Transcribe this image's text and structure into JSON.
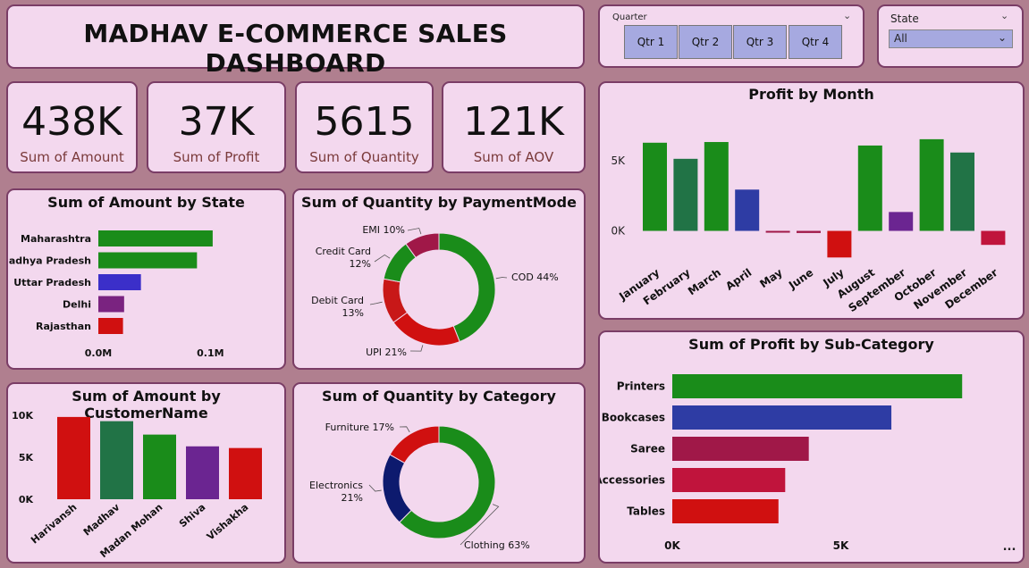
{
  "header": {
    "title": "MADHAV E-COMMERCE SALES DASHBOARD"
  },
  "quarter_slicer": {
    "label": "Quarter",
    "options": [
      "Qtr 1",
      "Qtr 2",
      "Qtr 3",
      "Qtr 4"
    ]
  },
  "state_slicer": {
    "label": "State",
    "selected": "All"
  },
  "kpis": [
    {
      "value": "438K",
      "label": "Sum of Amount"
    },
    {
      "value": "37K",
      "label": "Sum of Profit"
    },
    {
      "value": "5615",
      "label": "Sum of Quantity"
    },
    {
      "value": "121K",
      "label": "Sum of AOV"
    }
  ],
  "colors": {
    "green": "#1a8c1a",
    "dark_green": "#217346",
    "blue": "#2e3ca4",
    "purple": "#6b2591",
    "red": "#d01010",
    "maroon": "#a01848",
    "navy": "#0d1a6e"
  },
  "chart_data": [
    {
      "id": "profit_by_month",
      "type": "bar",
      "title": "Profit by Month",
      "categories": [
        "January",
        "February",
        "March",
        "April",
        "May",
        "June",
        "July",
        "August",
        "September",
        "October",
        "November",
        "December"
      ],
      "values": [
        6300,
        5150,
        6350,
        2950,
        -100,
        -150,
        -1900,
        6100,
        1350,
        6550,
        5600,
        -1000
      ],
      "colors": [
        "#1a8c1a",
        "#217346",
        "#1a8c1a",
        "#2e3ca4",
        "#a01848",
        "#a01848",
        "#d01010",
        "#1a8c1a",
        "#6b2591",
        "#1a8c1a",
        "#217346",
        "#c0143c"
      ],
      "yticks": [
        {
          "v": 0,
          "label": "0K"
        },
        {
          "v": 5000,
          "label": "5K"
        }
      ],
      "ylim": [
        -2200,
        7500
      ]
    },
    {
      "id": "amount_by_state",
      "type": "bar",
      "orientation": "horizontal",
      "title": "Sum of Amount by State",
      "categories": [
        "Maharashtra",
        "Madhya Pradesh",
        "Uttar Pradesh",
        "Delhi",
        "Rajasthan"
      ],
      "values": [
        102000,
        88000,
        38000,
        23000,
        22000
      ],
      "colors": [
        "#1a8c1a",
        "#1a8c1a",
        "#3b2fc9",
        "#7a2380",
        "#d01010"
      ],
      "xticks": [
        {
          "v": 0,
          "label": "0.0M"
        },
        {
          "v": 100000,
          "label": "0.1M"
        }
      ],
      "xlim": [
        0,
        130000
      ]
    },
    {
      "id": "quantity_by_paymentmode",
      "type": "pie",
      "title": "Sum of Quantity by PaymentMode",
      "slices": [
        {
          "name": "COD",
          "value": 44,
          "label": "COD 44%",
          "color": "#1a8c1a"
        },
        {
          "name": "UPI",
          "value": 21,
          "label": "UPI 21%",
          "color": "#d01010"
        },
        {
          "name": "Debit Card",
          "value": 13,
          "label": "Debit Card 13%",
          "color": "#c81818"
        },
        {
          "name": "Credit Card",
          "value": 12,
          "label": "Credit Card 12%",
          "color": "#1a8c1a"
        },
        {
          "name": "EMI",
          "value": 10,
          "label": "EMI 10%",
          "color": "#a01848"
        }
      ]
    },
    {
      "id": "profit_by_subcategory",
      "type": "bar",
      "orientation": "horizontal",
      "title": "Sum of Profit by Sub-Category",
      "categories": [
        "Printers",
        "Bookcases",
        "Saree",
        "Accessories",
        "Tables"
      ],
      "values": [
        8600,
        6500,
        4050,
        3350,
        3150
      ],
      "colors": [
        "#1a8c1a",
        "#2e3ca4",
        "#a01848",
        "#c0143c",
        "#d01010"
      ],
      "xticks": [
        {
          "v": 0,
          "label": "0K"
        },
        {
          "v": 5000,
          "label": "5K"
        }
      ],
      "xlim": [
        0,
        10000
      ],
      "more": "..."
    },
    {
      "id": "amount_by_customer",
      "type": "bar",
      "title": "Sum of Amount by CustomerName",
      "categories": [
        "Harivansh",
        "Madhav",
        "Madan Mohan",
        "Shiva",
        "Vishakha"
      ],
      "values": [
        9800,
        9300,
        7700,
        6300,
        6100
      ],
      "colors": [
        "#d01010",
        "#217346",
        "#1a8c1a",
        "#6b2591",
        "#d01010"
      ],
      "yticks": [
        {
          "v": 0,
          "label": "0K"
        },
        {
          "v": 5000,
          "label": "5K"
        },
        {
          "v": 10000,
          "label": "10K"
        }
      ],
      "ylim": [
        0,
        10000
      ]
    },
    {
      "id": "quantity_by_category",
      "type": "pie",
      "title": "Sum of Quantity by Category",
      "slices": [
        {
          "name": "Clothing",
          "value": 63,
          "label": "Clothing 63%",
          "color": "#1a8c1a"
        },
        {
          "name": "Electronics",
          "value": 21,
          "label": "Electronics 21%",
          "color": "#0d1a6e"
        },
        {
          "name": "Furniture",
          "value": 17,
          "label": "Furniture 17%",
          "color": "#d01010"
        }
      ]
    }
  ]
}
